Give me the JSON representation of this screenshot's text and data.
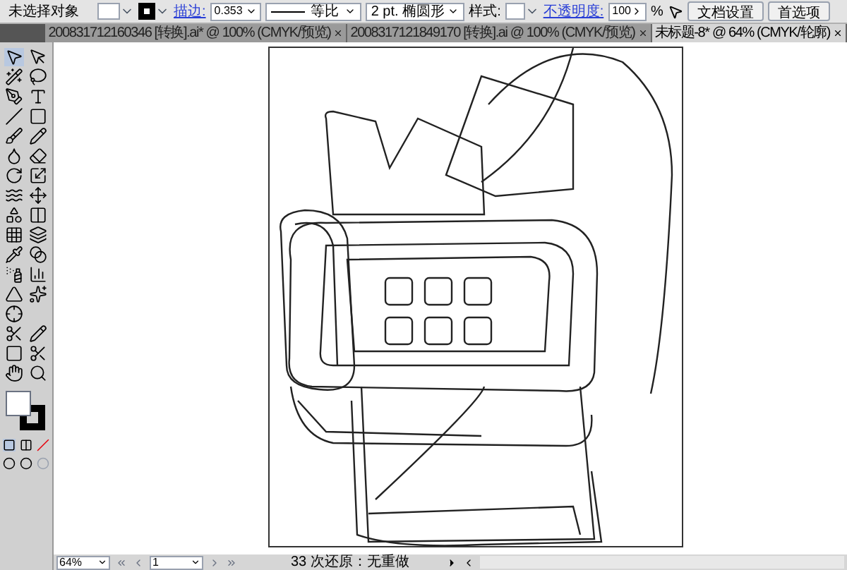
{
  "control_bar": {
    "selection": "未选择对象",
    "stroke_label": "描边:",
    "stroke_weight": "0.353",
    "stroke_profile": "等比",
    "brush": "2 pt. 椭圆形",
    "style_label": "样式:",
    "opacity_label": "不透明度:",
    "opacity": "100",
    "percent": "%",
    "buttons": [
      "文档设置",
      "首选项"
    ]
  },
  "tabs": [
    {
      "label": "200831712160346 [转换].ai* @ 100% (CMYK/预览)",
      "selected": false
    },
    {
      "label": "2008317121849170 [转换].ai @ 100% (CMYK/预览)",
      "selected": false
    },
    {
      "label": "未标题-8* @ 64% (CMYK/轮廓)",
      "selected": true
    }
  ],
  "status_bar": {
    "zoom": "64%",
    "page": "1",
    "status": "33 次还原：无重做"
  }
}
